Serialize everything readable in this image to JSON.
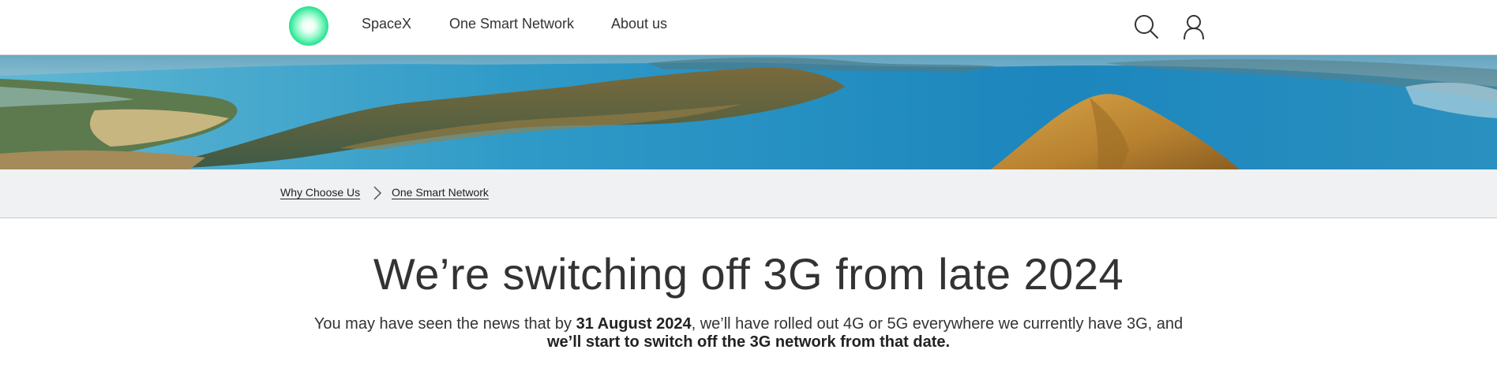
{
  "header": {
    "nav": [
      "SpaceX",
      "One Smart Network",
      "About us"
    ],
    "icons": [
      "search-icon",
      "user-account-icon"
    ],
    "logo_icon": "brand-circle-logo",
    "brand_color": "#26e18f"
  },
  "breadcrumb": {
    "items": [
      "Why Choose Us",
      "One Smart Network"
    ],
    "separator_icon": "chevron-right-icon"
  },
  "main": {
    "title": "We’re switching off 3G from late 2024",
    "intro": {
      "part1": "You may have seen the news that by ",
      "date": "31 August 2024",
      "part2": ", we’ll have rolled out 4G or 5G everywhere we currently have 3G, and",
      "emphasis": "we’ll start to switch off the 3G network from that date."
    }
  },
  "colors": {
    "text": "#333333",
    "breadcrumb_bg": "#f0f1f3",
    "lake": "#2b8fc0"
  }
}
